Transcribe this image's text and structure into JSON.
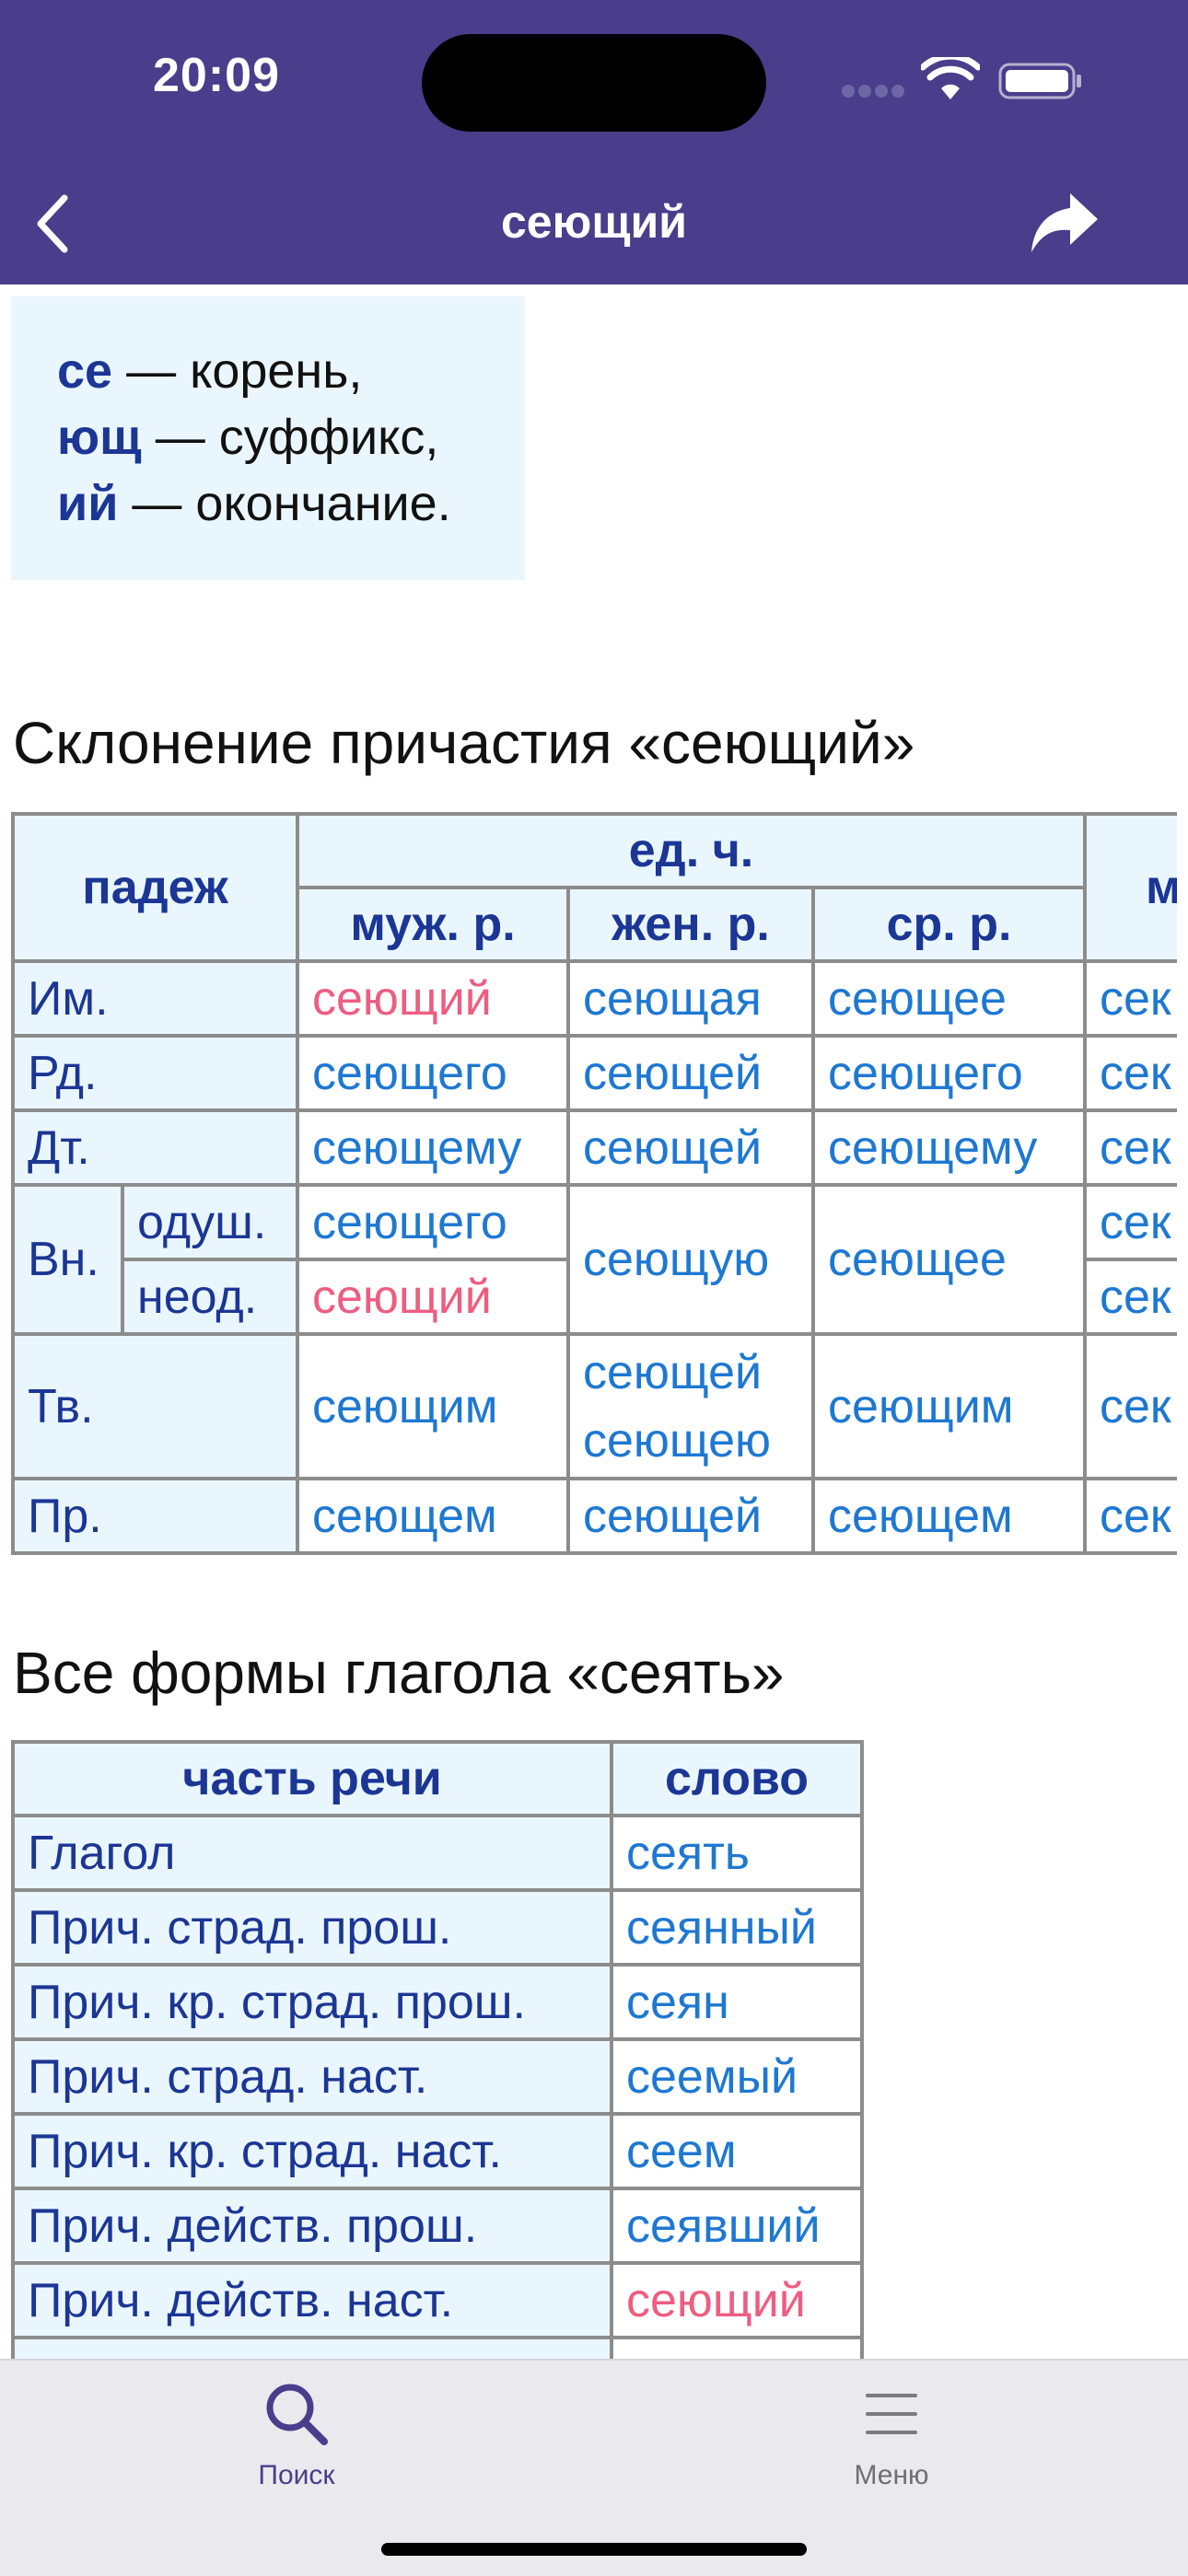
{
  "status_bar": {
    "time": "20:09"
  },
  "nav": {
    "title": "сеющий"
  },
  "morphemes": [
    {
      "part": "се",
      "text": " — корень,"
    },
    {
      "part": "ющ",
      "text": " — суффикс,"
    },
    {
      "part": "ий",
      "text": " — окончание."
    }
  ],
  "declension": {
    "title": "Склонение причастия «сеющий»",
    "headers": {
      "case": "падеж",
      "singular": "ед. ч.",
      "plural": "м",
      "masc": "муж. р.",
      "fem": "жен. р.",
      "neut": "ср. р."
    },
    "rows": {
      "nom": {
        "label": "Им.",
        "masc": "сеющий",
        "fem": "сеющая",
        "neut": "сеющее",
        "pl": "сек"
      },
      "gen": {
        "label": "Рд.",
        "masc": "сеющего",
        "fem": "сеющей",
        "neut": "сеющего",
        "pl": "сек"
      },
      "dat": {
        "label": "Дт.",
        "masc": "сеющему",
        "fem": "сеющей",
        "neut": "сеющему",
        "pl": "сек"
      },
      "acc": {
        "label": "Вн.",
        "anim": "одуш.",
        "inan": "неод.",
        "masc_anim": "сеющего",
        "masc_inan": "сеющий",
        "fem": "сеющую",
        "neut": "сеющее",
        "pl_anim": "сек",
        "pl_inan": "сек"
      },
      "ins": {
        "label": "Тв.",
        "masc": "сеющим",
        "fem1": "сеющей",
        "fem2": "сеющею",
        "neut": "сеющим",
        "pl": "сек"
      },
      "pre": {
        "label": "Пр.",
        "masc": "сеющем",
        "fem": "сеющей",
        "neut": "сеющем",
        "pl": "сек"
      }
    }
  },
  "forms": {
    "title": "Все формы глагола «сеять»",
    "headers": {
      "pos": "часть речи",
      "word": "слово"
    },
    "rows": [
      {
        "pos": "Глагол",
        "word": "сеять"
      },
      {
        "pos": "Прич. страд. прош.",
        "word": "сеянный"
      },
      {
        "pos": "Прич. кр. страд. прош.",
        "word": "сеян"
      },
      {
        "pos": "Прич. страд. наст.",
        "word": "сеемый"
      },
      {
        "pos": "Прич. кр. страд. наст.",
        "word": "сеем"
      },
      {
        "pos": "Прич. действ. прош.",
        "word": "сеявший"
      },
      {
        "pos": "Прич. действ. наст.",
        "word": "сеющий"
      }
    ]
  },
  "tabbar": {
    "search_label": "Поиск",
    "menu_label": "Меню",
    "active_color": "#4a3d8b",
    "inactive_color": "#6f6f73"
  },
  "colors": {
    "header_bg": "#4a3d8b",
    "label_text": "#1b3694",
    "form_text": "#1e78d2",
    "current_form_text": "#ee5d80",
    "cell_bg": "#eaf6fd"
  }
}
